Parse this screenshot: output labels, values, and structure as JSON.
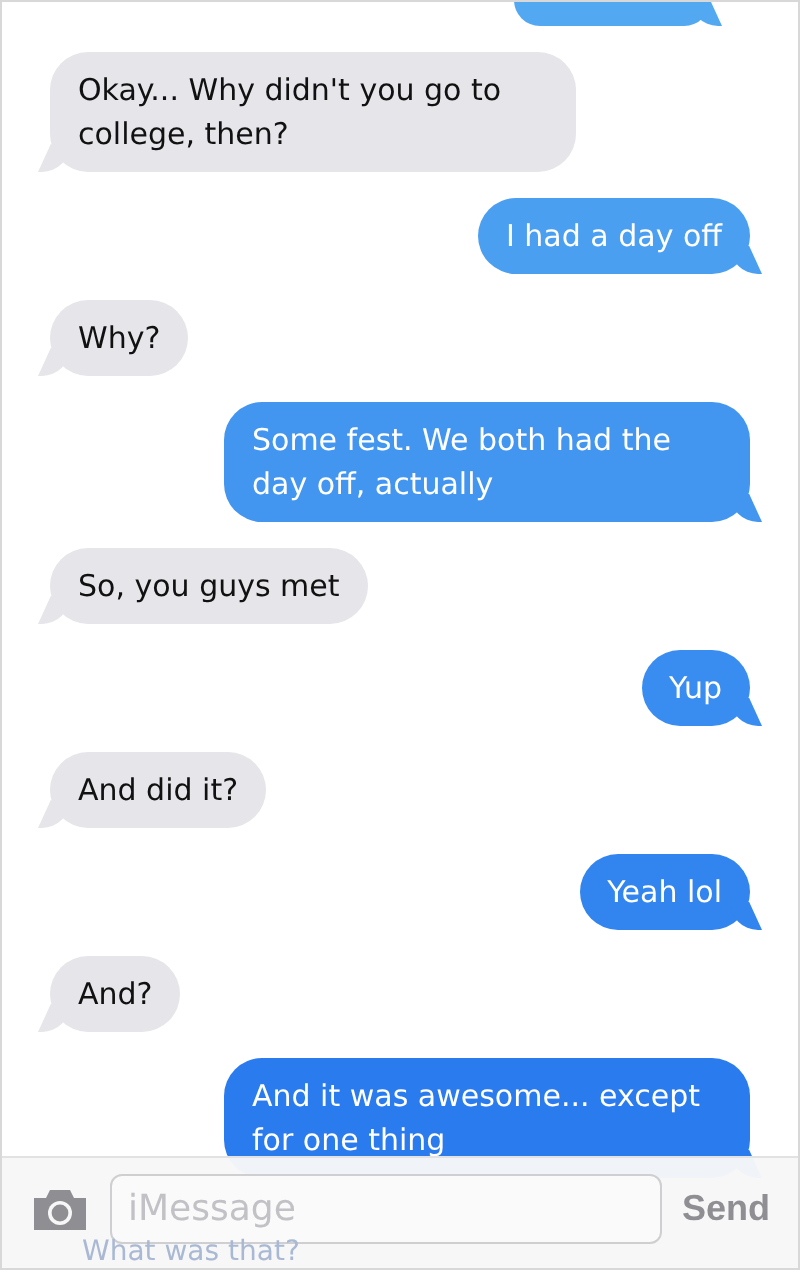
{
  "messages": [
    {
      "sent": true,
      "kind": "cut-off"
    },
    {
      "sent": false,
      "kind": "text",
      "text": "Okay... Why didn't you go to college, then?"
    },
    {
      "sent": true,
      "kind": "text",
      "text": "I had a day off"
    },
    {
      "sent": false,
      "kind": "text",
      "text": "Why?"
    },
    {
      "sent": true,
      "kind": "text",
      "text": "Some fest. We both had the day off, actually"
    },
    {
      "sent": false,
      "kind": "text",
      "text": "So, you guys met"
    },
    {
      "sent": true,
      "kind": "text",
      "text": "Yup"
    },
    {
      "sent": false,
      "kind": "text",
      "text": "And did it?"
    },
    {
      "sent": true,
      "kind": "text",
      "text": "Yeah lol"
    },
    {
      "sent": false,
      "kind": "text",
      "text": "And?"
    },
    {
      "sent": true,
      "kind": "text",
      "text": "And it was awesome... except for one thing"
    }
  ],
  "input_bar": {
    "placeholder": "iMessage",
    "send_label": "Send",
    "hidden_message": "What was that?"
  }
}
